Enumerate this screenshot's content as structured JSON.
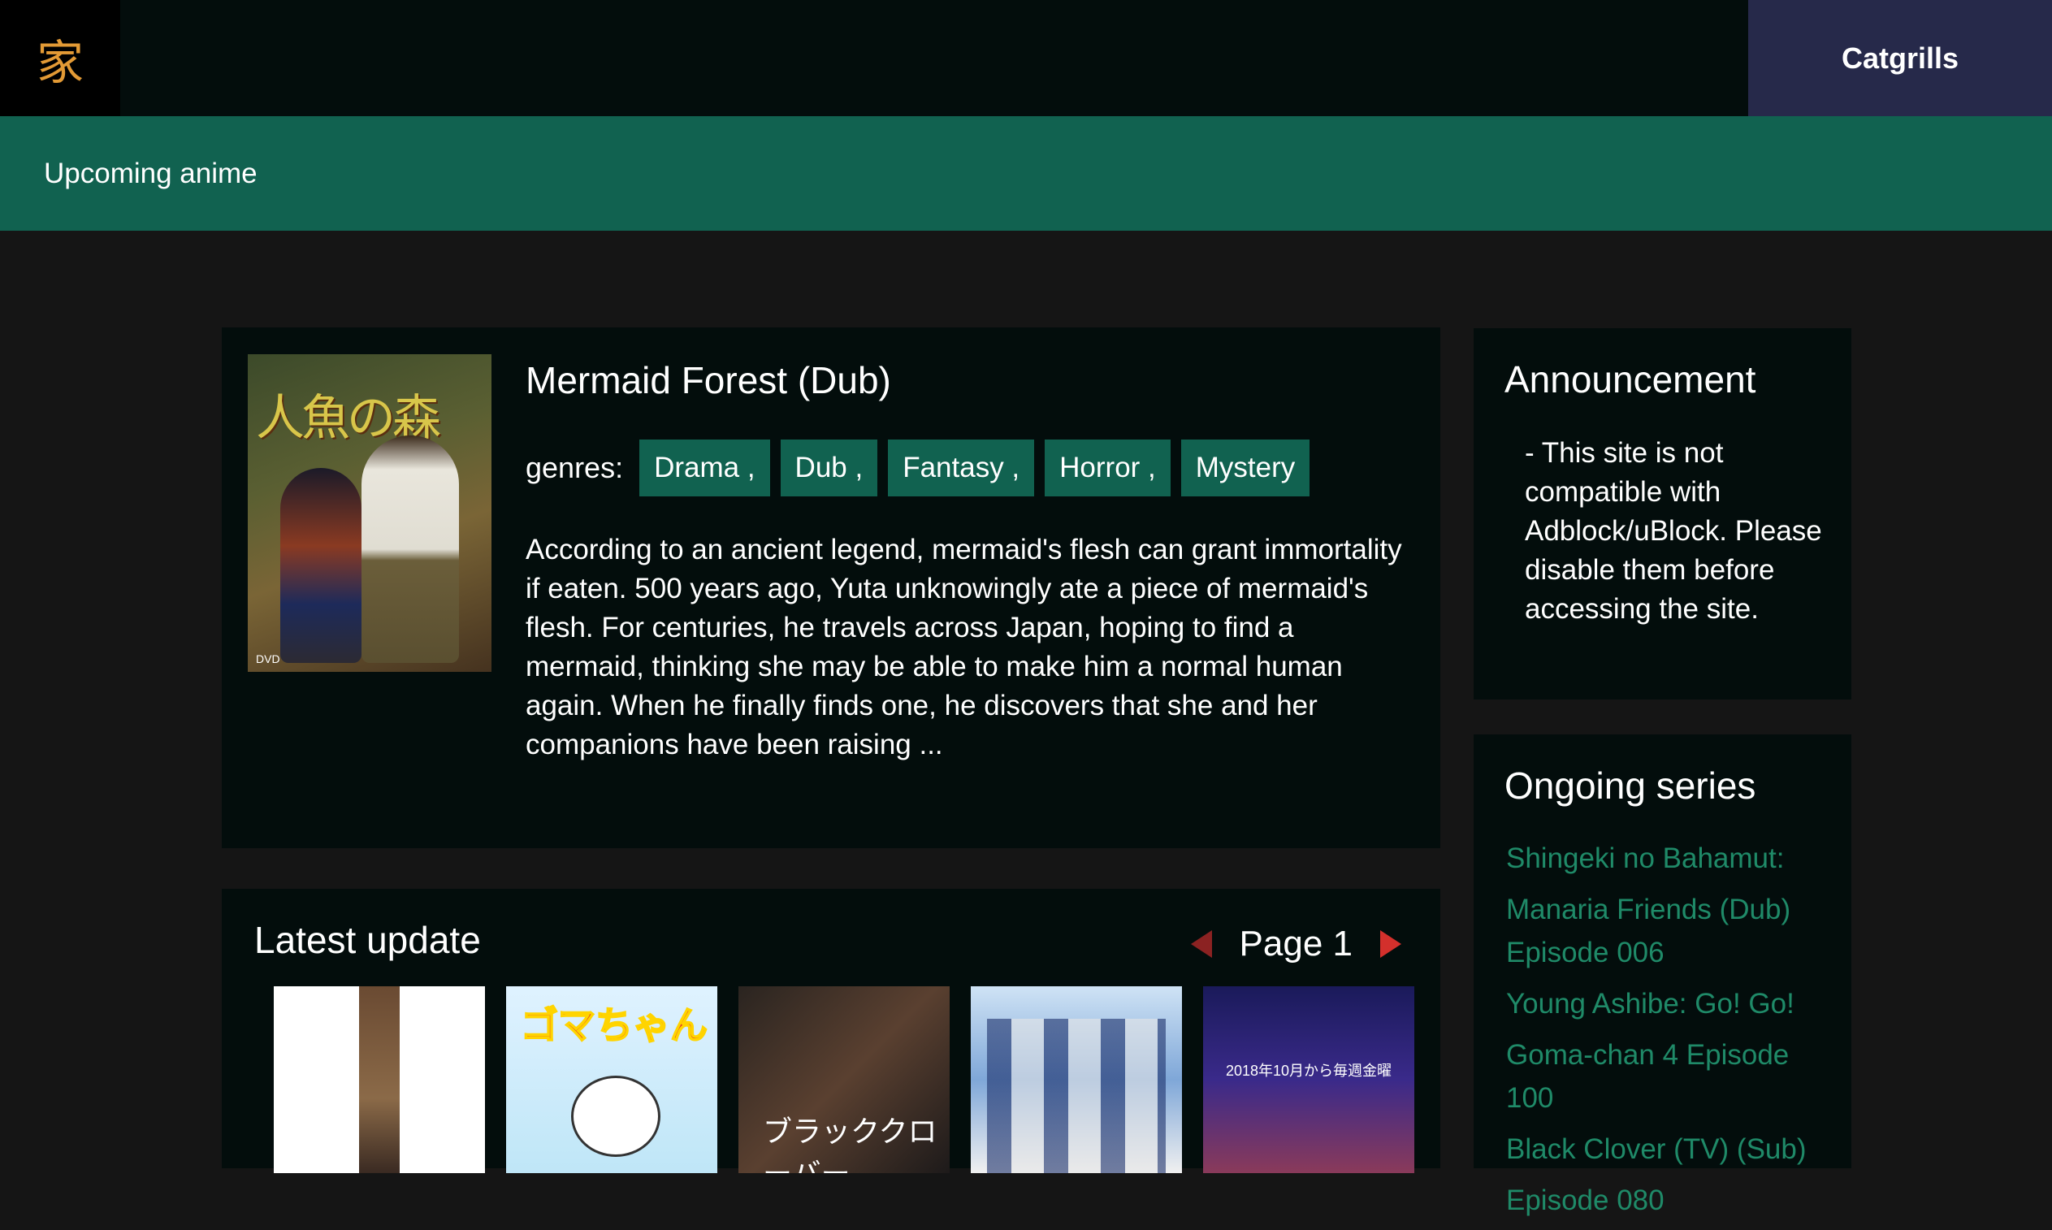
{
  "header": {
    "home_glyph": "家",
    "user_name": "Catgrills"
  },
  "subnav": {
    "link": "Upcoming anime"
  },
  "featured": {
    "title": "Mermaid Forest (Dub)",
    "genres_label": "genres:",
    "genres": [
      "Drama ,",
      "Dub ,",
      "Fantasy ,",
      "Horror ,",
      "Mystery"
    ],
    "description": "According to an ancient legend, mermaid's flesh can grant immortality if eaten. 500 years ago, Yuta unknowingly ate a piece of mermaid's flesh. For centuries, he travels across Japan, hoping to find a mermaid, thinking she may be able to make him a normal human again. When he finally finds one, he discovers that she and her companions have been raising ...",
    "cover_text": "人魚の森",
    "cover_badge": "DVD"
  },
  "latest": {
    "title": "Latest update",
    "page_label": "Page 1",
    "thumb_texts": {
      "goma": "ゴマちゃん",
      "black_clover": "ブラッククローバー",
      "inazuma": "2018年10月から毎週金曜"
    }
  },
  "announcement": {
    "title": "Announcement",
    "text": "- This site is not compatible with Adblock/uBlock. Please disable them before accessing the site."
  },
  "ongoing": {
    "title": "Ongoing series",
    "items": [
      "Shingeki no Bahamut:",
      "Manaria Friends (Dub) Episode 006",
      "Young Ashibe: Go! Go!",
      "Goma-chan 4 Episode 100",
      "Black Clover (TV) (Sub)",
      "Episode 080"
    ]
  },
  "colors": {
    "accent_green": "#116250",
    "link_green": "#1f8a68",
    "user_bg": "#26294a",
    "home_glyph": "#e39a35",
    "pager_arrow": "#d3302c"
  }
}
